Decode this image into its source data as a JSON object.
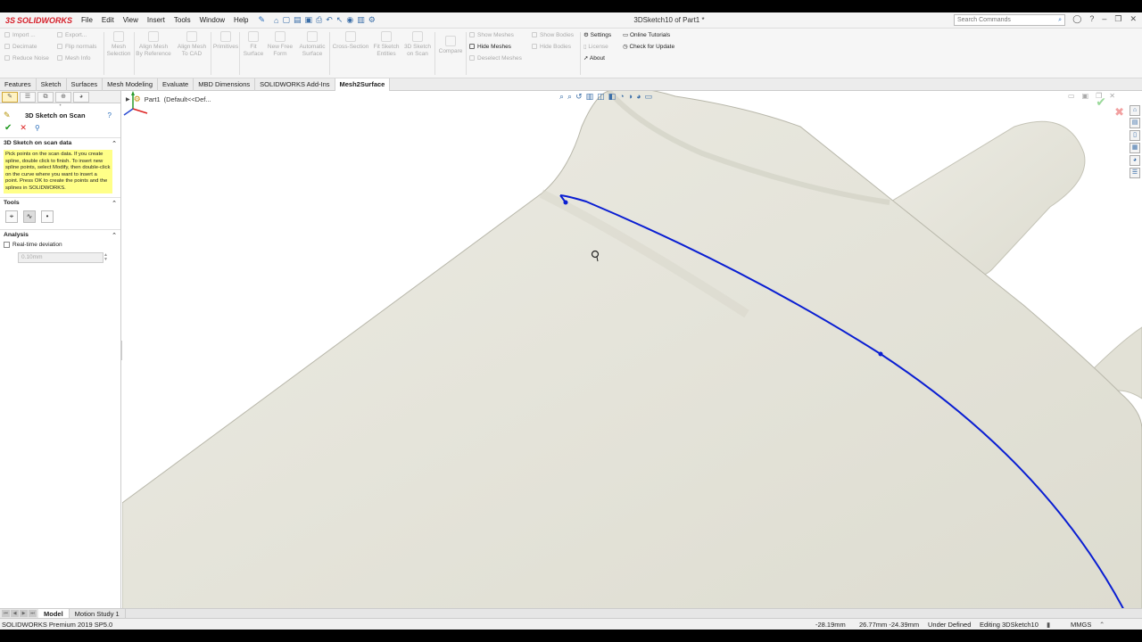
{
  "app": {
    "logo": "SOLIDWORKS",
    "logo_prefix": "3S",
    "title": "3DSketch10 of Part1 *",
    "search_placeholder": "Search Commands"
  },
  "menu": [
    "File",
    "Edit",
    "View",
    "Insert",
    "Tools",
    "Window",
    "Help"
  ],
  "command_manager": {
    "col1": [
      "Import ...",
      "Decimate",
      "Reduce Noise"
    ],
    "col2": [
      "Export...",
      "Flip normals",
      "Mesh Info"
    ],
    "mesh_selection": [
      "Mesh",
      "Selection"
    ],
    "align_by_ref": [
      "Align Mesh",
      "By Reference"
    ],
    "align_to_cad": [
      "Align Mesh",
      "To CAD"
    ],
    "primitives": [
      "Primitives"
    ],
    "fit_surface": [
      "Fit",
      "Surface"
    ],
    "new_free_form": [
      "New Free",
      "Form"
    ],
    "automatic_surface": [
      "Automatic",
      "Surface"
    ],
    "cross_section": [
      "Cross-Section"
    ],
    "fit_sketch": [
      "Fit Sketch",
      "Entities"
    ],
    "sketch_on_scan": [
      "3D Sketch",
      "on Scan"
    ],
    "compare": [
      "Compare"
    ],
    "show_meshes": "Show Meshes",
    "hide_meshes": "Hide Meshes",
    "deselect_meshes": "Deselect Meshes",
    "show_bodies": "Show Bodies",
    "hide_bodies": "Hide Bodies",
    "settings": "Settings",
    "license": "License",
    "about": "About",
    "online_tutorials": "Online Tutorials",
    "check_update": "Check for Update"
  },
  "tabs": [
    "Features",
    "Sketch",
    "Surfaces",
    "Mesh Modeling",
    "Evaluate",
    "MBD Dimensions",
    "SOLIDWORKS Add-Ins",
    "Mesh2Surface"
  ],
  "active_tab": "Mesh2Surface",
  "property_manager": {
    "title": "3D Sketch on Scan",
    "scan_group": "3D Sketch on scan data",
    "note": "Pick points on the scan data. If you create spline, double click to finish. To insert new spline points, select Modify, then double-click on the curve where you want to insert a point. Press OK to create the points and the splines in SOLIDWORKS.",
    "tools_group": "Tools",
    "analysis_group": "Analysis",
    "realtime_label": "Real-time deviation",
    "deviation_value": "0.10mm"
  },
  "tree": {
    "part": "Part1",
    "config": "(Default<<Def..."
  },
  "bottom_tabs": [
    "Model",
    "Motion Study 1"
  ],
  "status": {
    "product": "SOLIDWORKS Premium 2019 SP5.0",
    "coord1": "-28.19mm",
    "coord2": "26.77mm -24.39mm",
    "defined": "Under Defined",
    "editing": "Editing 3DSketch10",
    "units": "MMGS"
  },
  "colors": {
    "mesh_fill": "#e6e5db",
    "mesh_shadow": "#d2d1c5",
    "spline": "#0a1ed2",
    "accent": "#d6202a"
  }
}
